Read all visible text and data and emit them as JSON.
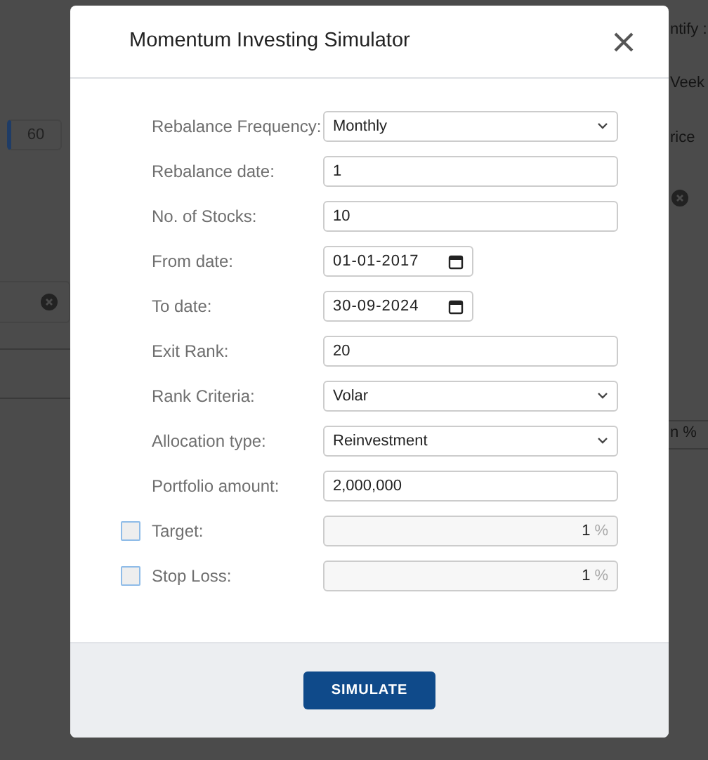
{
  "background": {
    "left_field_value": "60",
    "right_texts": [
      "ntify :",
      "Veek",
      "rice",
      "n %"
    ]
  },
  "modal": {
    "title": "Momentum Investing Simulator",
    "fields": [
      {
        "kind": "select",
        "label": "Rebalance Frequency:",
        "value": "Monthly"
      },
      {
        "kind": "text",
        "label": "Rebalance date:",
        "value": "1"
      },
      {
        "kind": "text",
        "label": "No. of Stocks:",
        "value": "10"
      },
      {
        "kind": "date",
        "label": "From date:",
        "value": "01-01-2017"
      },
      {
        "kind": "date",
        "label": "To date:",
        "value": "30-09-2024"
      },
      {
        "kind": "text",
        "label": "Exit Rank:",
        "value": "20"
      },
      {
        "kind": "select",
        "label": "Rank Criteria:",
        "value": "Volar"
      },
      {
        "kind": "select",
        "label": "Allocation type:",
        "value": "Reinvestment"
      },
      {
        "kind": "text",
        "label": "Portfolio amount:",
        "value": "2,000,000"
      },
      {
        "kind": "percent",
        "label": "Target:",
        "value": "1",
        "unit": "%",
        "checked": false
      },
      {
        "kind": "percent",
        "label": "Stop Loss:",
        "value": "1",
        "unit": "%",
        "checked": false
      }
    ],
    "button": "SIMULATE"
  }
}
